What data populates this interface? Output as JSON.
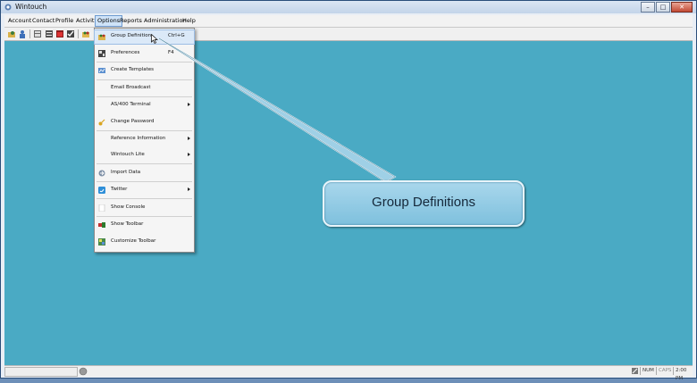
{
  "window": {
    "title": "Wintouch",
    "minimize": "–",
    "maximize": "□",
    "close": "✕"
  },
  "menubar": [
    "Account",
    "Contact",
    "Profile",
    "Activity",
    "Options",
    "Reports",
    "Administration",
    "Help"
  ],
  "options_menu": {
    "items": [
      {
        "label": "Group Definition",
        "shortcut": "Ctrl+G",
        "icon": "group-icon"
      },
      {
        "label": "Preferences",
        "shortcut": "F4",
        "icon": "preferences-icon"
      },
      {
        "label": "Create Templates",
        "shortcut": "",
        "icon": "templates-icon"
      },
      {
        "label": "Email Broadcast",
        "shortcut": "",
        "icon": ""
      },
      {
        "label": "AS/400 Terminal",
        "shortcut": "",
        "icon": ""
      },
      {
        "label": "Change Password",
        "shortcut": "",
        "icon": "key-icon"
      },
      {
        "label": "Reference Information",
        "shortcut": "",
        "icon": ""
      },
      {
        "label": "Wintouch Lite",
        "shortcut": "",
        "icon": ""
      },
      {
        "label": "Import Data",
        "shortcut": "",
        "icon": "import-icon"
      },
      {
        "label": "Twitter",
        "shortcut": "",
        "icon": "twitter-icon"
      },
      {
        "label": "Show Console",
        "shortcut": "",
        "icon": "console-icon"
      },
      {
        "label": "Show Toolbar",
        "shortcut": "",
        "icon": "toolbar-icon"
      },
      {
        "label": "Customize Toolbar",
        "shortcut": "",
        "icon": "customize-icon"
      }
    ]
  },
  "callout": {
    "text": "Group Definitions"
  },
  "statusbar": {
    "num": "NUM",
    "caps": "CAPS",
    "time": "2:00 PM"
  },
  "colors": {
    "client_bg": "#4aaac4",
    "callout_bg": "#8ecbe4",
    "menu_highlight": "#dbe9f8"
  }
}
